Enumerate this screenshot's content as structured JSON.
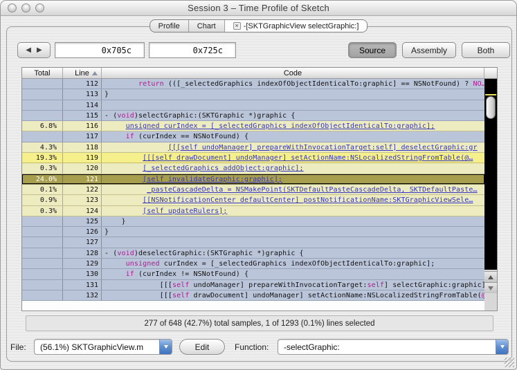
{
  "window": {
    "title": "Session 3 – Time Profile of Sketch"
  },
  "tabs": [
    {
      "label": "Profile",
      "active": false,
      "closable": false
    },
    {
      "label": "Chart",
      "active": false,
      "closable": false
    },
    {
      "label": "-[SKTGraphicView selectGraphic:]",
      "active": true,
      "closable": true
    }
  ],
  "toolbar": {
    "back_icon": "◀",
    "forward_icon": "▶",
    "address_start": "0x705c",
    "address_end": "0x725c",
    "view_buttons": [
      {
        "label": "Source",
        "active": true
      },
      {
        "label": "Assembly",
        "active": false
      },
      {
        "label": "Both",
        "active": false
      }
    ]
  },
  "table": {
    "columns": [
      "Total",
      "Line",
      "Code"
    ],
    "sort_column": "Line",
    "sort_direction": "ascending",
    "rows": [
      {
        "total": "",
        "line": "112",
        "pad": 8,
        "bg": "plain",
        "code": [
          [
            "k",
            "return"
          ],
          [
            "p",
            " (([_selectedGraphics indexOfObjectIdenticalTo:graphic] == NSNotFound) ? "
          ],
          [
            "k",
            "NO…"
          ]
        ]
      },
      {
        "total": "",
        "line": "113",
        "pad": 0,
        "bg": "plain",
        "code": [
          [
            "p",
            "}"
          ]
        ]
      },
      {
        "total": "",
        "line": "114",
        "pad": 0,
        "bg": "plain",
        "code": []
      },
      {
        "total": "",
        "line": "115",
        "pad": 0,
        "bg": "plain",
        "code": [
          [
            "p",
            "- ("
          ],
          [
            "k",
            "void"
          ],
          [
            "p",
            ")selectGraphic:(SKTGraphic *)graphic {"
          ]
        ]
      },
      {
        "total": "6.8%",
        "line": "116",
        "pad": 5,
        "bg": "hot1",
        "code": [
          [
            "l",
            "unsigned curIndex = [_selectedGraphics indexOfObjectIdenticalTo:graphic];"
          ]
        ]
      },
      {
        "total": "",
        "line": "117",
        "pad": 5,
        "bg": "plain",
        "code": [
          [
            "k",
            "if"
          ],
          [
            "p",
            " (curIndex == NSNotFound) {"
          ]
        ]
      },
      {
        "total": "4.3%",
        "line": "118",
        "pad": 15,
        "bg": "hot1",
        "code": [
          [
            "l",
            "[[[self undoManager] prepareWithInvocationTarget:self] deselectGraphic:gr"
          ]
        ]
      },
      {
        "total": "19.3%",
        "line": "119",
        "pad": 9,
        "bg": "hot2",
        "code": [
          [
            "l",
            "[[[self drawDocument] undoManager] setActionName:NSLocalizedStringFromTable(@…"
          ]
        ]
      },
      {
        "total": "0.3%",
        "line": "120",
        "pad": 9,
        "bg": "hot1",
        "code": [
          [
            "l",
            "[_selectedGraphics addObject:graphic];"
          ]
        ]
      },
      {
        "total": "24.0%",
        "line": "121",
        "pad": 9,
        "bg": "sel",
        "code": [
          [
            "l",
            "[self invalidateGraphic:graphic];"
          ]
        ]
      },
      {
        "total": "0.1%",
        "line": "122",
        "pad": 10,
        "bg": "hot1",
        "code": [
          [
            "l",
            "_pasteCascadeDelta = NSMakePoint(SKTDefaultPasteCascadeDelta, SKTDefaultPaste…"
          ]
        ]
      },
      {
        "total": "0.9%",
        "line": "123",
        "pad": 9,
        "bg": "hot1",
        "code": [
          [
            "l",
            "[[NSNotificationCenter defaultCenter] postNotificationName:SKTGraphicViewSele…"
          ]
        ]
      },
      {
        "total": "0.3%",
        "line": "124",
        "pad": 9,
        "bg": "hot1",
        "code": [
          [
            "l",
            "[self updateRulers];"
          ]
        ]
      },
      {
        "total": "",
        "line": "125",
        "pad": 4,
        "bg": "plain",
        "code": [
          [
            "p",
            "}"
          ]
        ]
      },
      {
        "total": "",
        "line": "126",
        "pad": 0,
        "bg": "plain",
        "code": [
          [
            "p",
            "}"
          ]
        ]
      },
      {
        "total": "",
        "line": "127",
        "pad": 0,
        "bg": "plain",
        "code": []
      },
      {
        "total": "",
        "line": "128",
        "pad": 0,
        "bg": "plain",
        "code": [
          [
            "p",
            "- ("
          ],
          [
            "k",
            "void"
          ],
          [
            "p",
            ")deselectGraphic:(SKTGraphic *)graphic {"
          ]
        ]
      },
      {
        "total": "",
        "line": "129",
        "pad": 5,
        "bg": "plain",
        "code": [
          [
            "k",
            "unsigned"
          ],
          [
            "p",
            " curIndex = [_selectedGraphics indexOfObjectIdenticalTo:graphic];"
          ]
        ]
      },
      {
        "total": "",
        "line": "130",
        "pad": 5,
        "bg": "plain",
        "code": [
          [
            "k",
            "if"
          ],
          [
            "p",
            " (curIndex != NSNotFound) {"
          ]
        ]
      },
      {
        "total": "",
        "line": "131",
        "pad": 13,
        "bg": "plain",
        "code": [
          [
            "p",
            "[[["
          ],
          [
            "k",
            "self"
          ],
          [
            "p",
            " undoManager] prepareWithInvocationTarget:"
          ],
          [
            "k",
            "self"
          ],
          [
            "p",
            "] selectGraphic:graphic];"
          ]
        ]
      },
      {
        "total": "",
        "line": "132",
        "pad": 13,
        "bg": "plain",
        "code": [
          [
            "p",
            "[[["
          ],
          [
            "k",
            "self"
          ],
          [
            "p",
            " drawDocument] undoManager] setActionName:NSLocalizedStringFromTable("
          ],
          [
            "k",
            "@…"
          ]
        ]
      }
    ]
  },
  "statusbar": {
    "text": "277 of 648 (42.7%) total samples, 1 of 1293 (0.1%) lines selected"
  },
  "footer": {
    "file_label": "File:",
    "file_value": "(56.1%) SKTGraphicView.m",
    "edit_label": "Edit",
    "function_label": "Function:",
    "function_value": "-selectGraphic:"
  },
  "colors": {
    "row_plain": "#bac5da",
    "row_hot": "#edebc0",
    "row_hot_bright": "#f5ef8c",
    "row_selected": "#a79e4e",
    "link_text": "#3434bf",
    "keyword_text": "#a8208e",
    "popup_accent": "#5e8fd0",
    "scroll_track": "#000000",
    "scroll_marker": "#e8e05a"
  }
}
